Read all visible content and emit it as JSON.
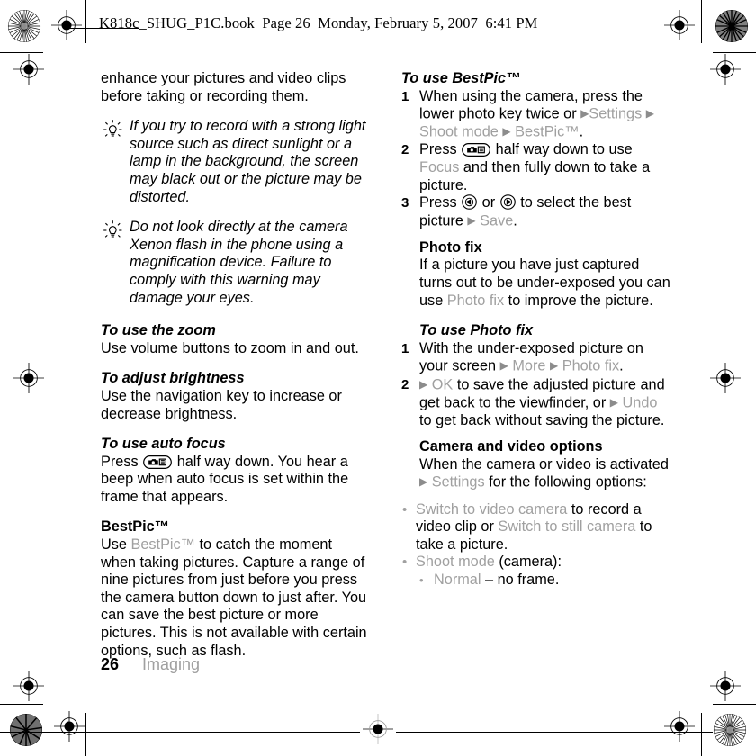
{
  "header": {
    "text": "K818c_SHUG_P1C.book  Page 26  Monday, February 5, 2007  6:41 PM"
  },
  "colors": {
    "menu_gray": "#a0a0a0",
    "text_black": "#000000",
    "footer_gray": "#a0a0a0"
  },
  "left_column": {
    "intro": {
      "line1": "enhance your pictures and video clips",
      "line2": "before taking or recording them."
    },
    "tips": [
      {
        "icon": "lightbulb-icon",
        "text": "If you try to record with a strong light source such as direct sunlight or a lamp in the background, the screen may black out or the picture may be distorted."
      },
      {
        "icon": "lightbulb-icon",
        "text": "Do not look directly at the camera Xenon flash in the phone using a magnification device. Failure to comply with this warning may damage your eyes."
      }
    ],
    "zoom_section": {
      "heading": "To use the zoom",
      "body": "Use volume buttons to zoom in and out."
    },
    "brightness_section": {
      "heading": "To adjust brightness",
      "body": "Use the navigation key to increase or decrease brightness."
    },
    "autofocus_section": {
      "heading": "To use auto focus",
      "press_label": "Press",
      "key_icon": "camera-key-icon",
      "body_after_key": "half way down. You hear a beep when auto focus is set within the frame that appears."
    },
    "bestpic_section": {
      "heading": "BestPic™",
      "part1": "Use ",
      "menu_term": "BestPic™",
      "part2": " to catch the moment when taking pictures. Capture a range of nine pictures from just before you press the camera button down to just after. You can save the best picture or more pictures. This is not available with certain options, such as flash."
    }
  },
  "right_column": {
    "use_bestpic": {
      "heading": "To use BestPic™",
      "steps": [
        {
          "num": "1",
          "seg1": "When using the camera, press the lower photo key twice or ",
          "arrow1": "▶",
          "menu1": "Settings",
          "arrow2": "▶",
          "menu2": "Shoot mode",
          "arrow3": "▶",
          "menu3": "BestPic™",
          "seg_end": "."
        },
        {
          "num": "2",
          "seg1": "Press ",
          "key_icon": "camera-key-icon",
          "seg2": " half way down to use ",
          "menu1": "Focus",
          "seg3": " and then fully down to take a picture."
        },
        {
          "num": "3",
          "seg1": "Press ",
          "key_icon_left": "nav-key-left-icon",
          "seg2": " or ",
          "key_icon_right": "nav-key-right-icon",
          "seg3": " to select the best picture ",
          "arrow1": "▶",
          "menu1": "Save",
          "seg_end": "."
        }
      ]
    },
    "photo_fix": {
      "heading": "Photo fix",
      "part1": "If a picture you have just captured turns out to be under-exposed you can use ",
      "menu_term": "Photo fix",
      "part2": " to improve the picture."
    },
    "use_photo_fix": {
      "heading": "To use Photo fix",
      "steps": [
        {
          "num": "1",
          "seg1": "With the under-exposed picture on your screen ",
          "arrow1": "▶",
          "menu1": "More",
          "arrow2": "▶",
          "menu2": "Photo fix",
          "seg_end": "."
        },
        {
          "num": "2",
          "arrow1": "▶",
          "menu1": "OK",
          "seg1": " to save the adjusted picture and get back to the viewfinder, or ",
          "arrow2": "▶",
          "menu2": "Undo",
          "seg2": " to get back without saving the picture."
        }
      ]
    },
    "camera_video_options": {
      "heading": "Camera and video options",
      "intro1": "When the camera or video is activated ",
      "arrow1": "▶",
      "menu1": "Settings",
      "intro2": " for the following options:",
      "bullets": [
        {
          "menu1": "Switch to video camera",
          "seg1": " to record a video clip or ",
          "menu2": "Switch to still camera",
          "seg2": " to take a picture."
        },
        {
          "menu1": "Shoot mode",
          "seg1": " (camera):"
        }
      ],
      "subbullets": [
        {
          "menu1": "Normal",
          "seg1": " – no frame."
        }
      ]
    }
  },
  "footer": {
    "page_number": "26",
    "section": "Imaging"
  }
}
